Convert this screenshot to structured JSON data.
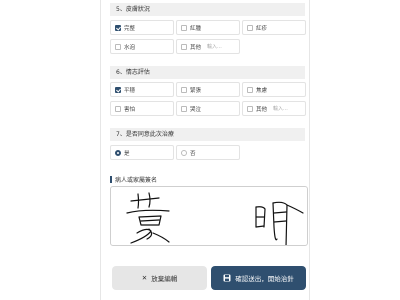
{
  "sections": [
    {
      "title": "5、皮膚狀況",
      "options": [
        {
          "label": "完整",
          "checked": true
        },
        {
          "label": "紅腫",
          "checked": false
        },
        {
          "label": "紅疹",
          "checked": false
        },
        {
          "label": "水泡",
          "checked": false
        },
        {
          "label": "其他",
          "checked": false,
          "placeholder": "輸入..."
        }
      ]
    },
    {
      "title": "6、情志評估",
      "options": [
        {
          "label": "平穩",
          "checked": true
        },
        {
          "label": "緊張",
          "checked": false
        },
        {
          "label": "焦慮",
          "checked": false
        },
        {
          "label": "害怕",
          "checked": false
        },
        {
          "label": "哭泣",
          "checked": false
        },
        {
          "label": "其他",
          "checked": false,
          "placeholder": "輸入..."
        }
      ]
    },
    {
      "title": "7、是否同意此次治療",
      "options": [
        {
          "label": "是",
          "selected": true
        },
        {
          "label": "否",
          "selected": false
        }
      ]
    }
  ],
  "signature": {
    "label": "病人或家屬簽名",
    "ink_color": "#111111"
  },
  "actions": {
    "cancel_label": "放棄編輯",
    "confirm_label": "確認送出，開始治針"
  },
  "colors": {
    "accent": "#2f4f6f",
    "section_bg": "#f0f0f0"
  }
}
